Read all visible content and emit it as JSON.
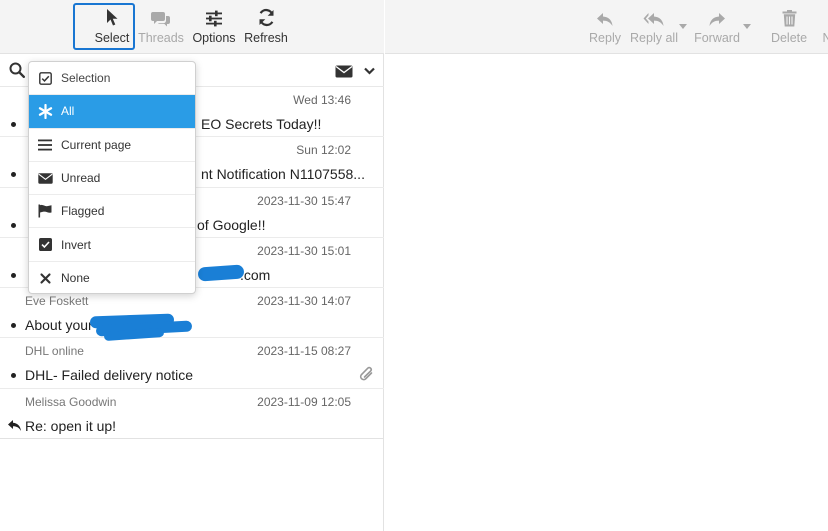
{
  "toolbar": {
    "select_label": "Select",
    "threads_label": "Threads",
    "options_label": "Options",
    "refresh_label": "Refresh"
  },
  "reading_toolbar": {
    "reply_label": "Reply",
    "reply_all_label": "Reply all",
    "forward_label": "Forward",
    "delete_label": "Delete",
    "more_label": "N"
  },
  "select_menu": {
    "items": [
      {
        "label": "Selection",
        "icon": "checkbox-icon"
      },
      {
        "label": "All",
        "icon": "asterisk-icon"
      },
      {
        "label": "Current page",
        "icon": "list-icon"
      },
      {
        "label": "Unread",
        "icon": "envelope-icon"
      },
      {
        "label": "Flagged",
        "icon": "flag-icon"
      },
      {
        "label": "Invert",
        "icon": "checked-box-icon"
      },
      {
        "label": "None",
        "icon": "x-icon"
      }
    ],
    "active": "All"
  },
  "messages": [
    {
      "from": "",
      "date": "Wed 13:46",
      "subject": "EO Secrets Today!!"
    },
    {
      "from": "",
      "date": "Sun 12:02",
      "subject": "nt Notification N1107558..."
    },
    {
      "from": "",
      "date": "2023-11-30 15:47",
      "subject": "of Google!!"
    },
    {
      "from": "",
      "date": "2023-11-30 15:01",
      "subject": ".com"
    },
    {
      "from": "Eve Foskett",
      "date": "2023-11-30 14:07",
      "subject": "About your"
    },
    {
      "from": "DHL online",
      "date": "2023-11-15 08:27",
      "subject": "DHL- Failed delivery notice"
    },
    {
      "from": "Melissa Goodwin",
      "date": "2023-11-09 12:05",
      "subject": "Re: open it up!"
    }
  ],
  "colors": {
    "accent": "#2a9ce6",
    "highlight_box": "#1976d2",
    "redaction": "#1a7fd6",
    "toolbar_bg": "#f4f4f4"
  }
}
